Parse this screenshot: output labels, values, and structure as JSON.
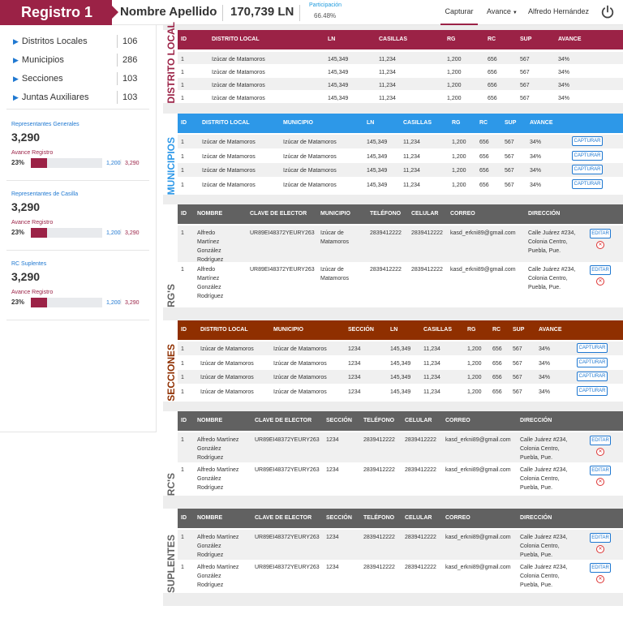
{
  "header": {
    "brand": "Registro 1",
    "user_name": "Nombre Apellido",
    "ln_total": "170,739 LN",
    "participacion_label": "Participación",
    "participacion_value": "66.48%",
    "nav_capturar": "Capturar",
    "nav_avance": "Avance",
    "nav_user": "Alfredo Hernández",
    "power_icon": "power-icon"
  },
  "colors": {
    "brand": "#9b2246",
    "municipios": "#2d98e8",
    "rgs": "#616161",
    "secciones": "#8f2f00",
    "link": "#1f78d1"
  },
  "sidebar": {
    "items": [
      {
        "label": "Distritos Locales",
        "count": "106"
      },
      {
        "label": "Municipios",
        "count": "286"
      },
      {
        "label": "Secciones",
        "count": "103"
      },
      {
        "label": "Juntas Auxiliares",
        "count": "103"
      }
    ],
    "stats": [
      {
        "label": "Representantes Generales",
        "value": "3,290",
        "avance_label": "Avance Registro",
        "pct": "23%",
        "fraction": 0.23,
        "a": "1,200",
        "b": "3,290"
      },
      {
        "label": "Representantes de Casilla",
        "value": "3,290",
        "avance_label": "Avance Registro",
        "pct": "23%",
        "fraction": 0.23,
        "a": "1,200",
        "b": "3,290"
      },
      {
        "label": "RC Suplentes",
        "value": "3,290",
        "avance_label": "Avance Registro",
        "pct": "23%",
        "fraction": 0.23,
        "a": "1,200",
        "b": "3,290"
      }
    ]
  },
  "distrito": {
    "title": "Distrito Local",
    "headers": [
      "ID",
      "DISTRITO LOCAL",
      "LN",
      "CASILLAS",
      "RG",
      "RC",
      "SUP",
      "AVANCE"
    ],
    "rows": [
      [
        "1",
        "Izúcar de Matamoros",
        "145,349",
        "11,234",
        "1,200",
        "656",
        "567",
        "34%"
      ],
      [
        "1",
        "Izúcar de Matamoros",
        "145,349",
        "11,234",
        "1,200",
        "656",
        "567",
        "34%"
      ],
      [
        "1",
        "Izúcar de Matamoros",
        "145,349",
        "11,234",
        "1,200",
        "656",
        "567",
        "34%"
      ],
      [
        "1",
        "Izúcar de Matamoros",
        "145,349",
        "11,234",
        "1,200",
        "656",
        "567",
        "34%"
      ]
    ]
  },
  "municipios": {
    "title": "Municipios",
    "headers": [
      "ID",
      "DISTRITO LOCAL",
      "MUNICIPIO",
      "LN",
      "CASILLAS",
      "RG",
      "RC",
      "SUP",
      "AVANCE"
    ],
    "button": "CAPTURAR",
    "rows": [
      [
        "1",
        "Izúcar de Matamoros",
        "Izúcar de Matamoros",
        "145,349",
        "11,234",
        "1,200",
        "656",
        "567",
        "34%"
      ],
      [
        "1",
        "Izúcar de Matamoros",
        "Izúcar de Matamoros",
        "145,349",
        "11,234",
        "1,200",
        "656",
        "567",
        "34%"
      ],
      [
        "1",
        "Izúcar de Matamoros",
        "Izúcar de Matamoros",
        "145,349",
        "11,234",
        "1,200",
        "656",
        "567",
        "34%"
      ],
      [
        "1",
        "Izúcar de Matamoros",
        "Izúcar de Matamoros",
        "145,349",
        "11,234",
        "1,200",
        "656",
        "567",
        "34%"
      ]
    ]
  },
  "rgs": {
    "title": "RG's",
    "headers": [
      "ID",
      "NOMBRE",
      "CLAVE DE ELECTOR",
      "MUNICIPIO",
      "TELÉFONO",
      "CELULAR",
      "CORREO",
      "DIRECCIÓN"
    ],
    "button": "EDITAR",
    "delete_icon": "close-icon",
    "rows": [
      {
        "id": "1",
        "nombre": [
          "Alfredo",
          "Martínez",
          "González",
          "Rodríguez"
        ],
        "clave": "UR89EI48372YEURY263",
        "municipio": [
          "Izúcar de",
          "Matamoros"
        ],
        "telefono": "2839412222",
        "celular": "2839412222",
        "correo": "kasd_erkni89@gmail.com",
        "direccion": [
          "Calle Juárez #234,",
          "Colonia Centro,",
          "Puebla, Pue."
        ]
      },
      {
        "id": "1",
        "nombre": [
          "Alfredo",
          "Martínez",
          "González",
          "Rodríguez"
        ],
        "clave": "UR89EI48372YEURY263",
        "municipio": [
          "Izúcar de",
          "Matamoros"
        ],
        "telefono": "2839412222",
        "celular": "2839412222",
        "correo": "kasd_erkni89@gmail.com",
        "direccion": [
          "Calle Juárez #234,",
          "Colonia Centro,",
          "Puebla, Pue."
        ]
      }
    ]
  },
  "secciones": {
    "title": "Secciones",
    "headers": [
      "ID",
      "DISTRITO LOCAL",
      "MUNICIPIO",
      "SECCIÓN",
      "LN",
      "CASILLAS",
      "RG",
      "RC",
      "SUP",
      "AVANCE"
    ],
    "button": "CAPTURAR",
    "rows": [
      [
        "1",
        "Izúcar de Matamoros",
        "Izúcar de Matamoros",
        "1234",
        "145,349",
        "11,234",
        "1,200",
        "656",
        "567",
        "34%"
      ],
      [
        "1",
        "Izúcar de Matamoros",
        "Izúcar de Matamoros",
        "1234",
        "145,349",
        "11,234",
        "1,200",
        "656",
        "567",
        "34%"
      ],
      [
        "1",
        "Izúcar de Matamoros",
        "Izúcar de Matamoros",
        "1234",
        "145,349",
        "11,234",
        "1,200",
        "656",
        "567",
        "34%"
      ],
      [
        "1",
        "Izúcar de Matamoros",
        "Izúcar de Matamoros",
        "1234",
        "145,349",
        "11,234",
        "1,200",
        "656",
        "567",
        "34%"
      ]
    ]
  },
  "rcs": {
    "title": "RC's",
    "headers": [
      "ID",
      "NOMBRE",
      "CLAVE DE ELECTOR",
      "SECCIÓN",
      "TELÉFONO",
      "CELULAR",
      "CORREO",
      "DIRECCIÓN"
    ],
    "button": "EDITAR",
    "delete_icon": "close-icon",
    "rows": [
      {
        "id": "1",
        "nombre": [
          "Alfredo Martínez",
          "González",
          "Rodríguez"
        ],
        "clave": "UR89EI48372YEURY263",
        "seccion": "1234",
        "telefono": "2839412222",
        "celular": "2839412222",
        "correo": "kasd_erkni89@gmail.com",
        "direccion": [
          "Calle Juárez #234,",
          "Colonia Centro,",
          "Puebla, Pue."
        ]
      },
      {
        "id": "1",
        "nombre": [
          "Alfredo Martínez",
          "González",
          "Rodríguez"
        ],
        "clave": "UR89EI48372YEURY263",
        "seccion": "1234",
        "telefono": "2839412222",
        "celular": "2839412222",
        "correo": "kasd_erkni89@gmail.com",
        "direccion": [
          "Calle Juárez #234,",
          "Colonia Centro,",
          "Puebla, Pue."
        ]
      }
    ]
  },
  "suplentes": {
    "title": "Suplentes",
    "headers": [
      "ID",
      "NOMBRE",
      "CLAVE DE ELECTOR",
      "SECCIÓN",
      "TELÉFONO",
      "CELULAR",
      "CORREO",
      "DIRECCIÓN"
    ],
    "button": "EDITAR",
    "delete_icon": "close-icon",
    "rows": [
      {
        "id": "1",
        "nombre": [
          "Alfredo Martínez",
          "González",
          "Rodríguez"
        ],
        "clave": "UR89EI48372YEURY263",
        "seccion": "1234",
        "telefono": "2839412222",
        "celular": "2839412222",
        "correo": "kasd_erkni89@gmail.com",
        "direccion": [
          "Calle Juárez #234,",
          "Colonia Centro,",
          "Puebla, Pue."
        ]
      },
      {
        "id": "1",
        "nombre": [
          "Alfredo Martínez",
          "González",
          "Rodríguez"
        ],
        "clave": "UR89EI48372YEURY263",
        "seccion": "1234",
        "telefono": "2839412222",
        "celular": "2839412222",
        "correo": "kasd_erkni89@gmail.com",
        "direccion": [
          "Calle Juárez #234,",
          "Colonia Centro,",
          "Puebla, Pue."
        ]
      }
    ]
  }
}
